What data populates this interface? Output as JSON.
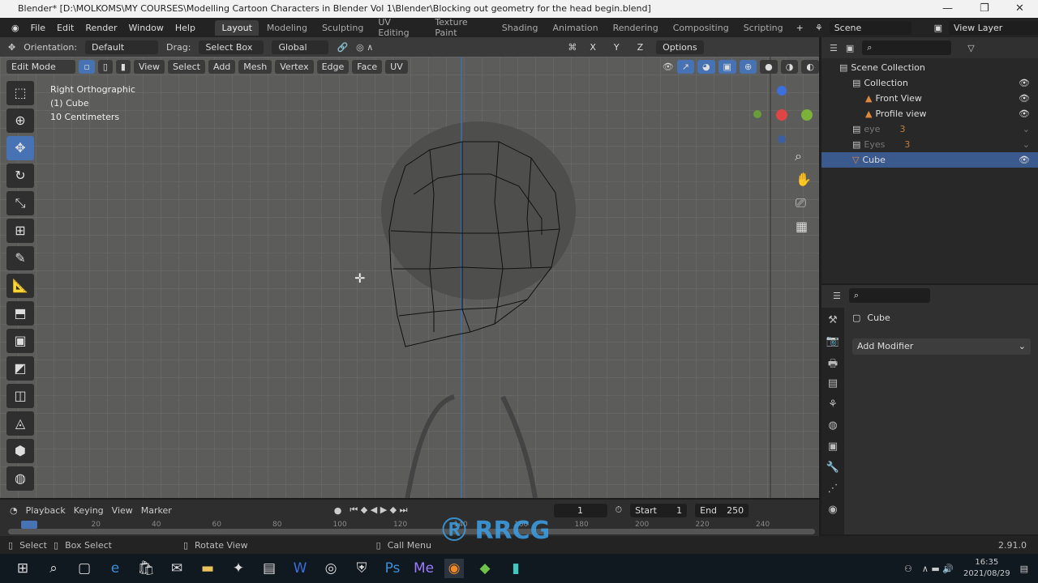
{
  "window": {
    "title": "Blender* [D:\\MOLKOMS\\MY COURSES\\Modelling  Cartoon Characters in Blender Vol 1\\Blender\\Blocking out geometry for the head begin.blend]"
  },
  "menu": [
    "File",
    "Edit",
    "Render",
    "Window",
    "Help"
  ],
  "workspaces": [
    "Layout",
    "Modeling",
    "Sculpting",
    "UV Editing",
    "Texture Paint",
    "Shading",
    "Animation",
    "Rendering",
    "Compositing",
    "Scripting"
  ],
  "scene": "Scene",
  "view_layer": "View Layer",
  "tool_header": {
    "orientation_label": "Orientation:",
    "orientation": "Default",
    "drag_label": "Drag:",
    "drag": "Select Box",
    "transform": "Global",
    "axes": [
      "X",
      "Y",
      "Z"
    ],
    "options": "Options"
  },
  "viewport_header": {
    "mode": "Edit Mode",
    "menus": [
      "View",
      "Select",
      "Add",
      "Mesh",
      "Vertex",
      "Edge",
      "Face",
      "UV"
    ]
  },
  "viewport_info": [
    "Right Orthographic",
    "(1) Cube",
    "10 Centimeters"
  ],
  "outliner": {
    "items": [
      {
        "label": "Scene Collection",
        "indent": 0
      },
      {
        "label": "Collection",
        "indent": 1
      },
      {
        "label": "Front View",
        "indent": 2
      },
      {
        "label": "Profile view",
        "indent": 2
      },
      {
        "label": "eye",
        "indent": 1,
        "dim": true,
        "badge": "3"
      },
      {
        "label": "Eyes",
        "indent": 1,
        "dim": true,
        "badge": "3"
      },
      {
        "label": "Cube",
        "indent": 1,
        "selected": true
      }
    ]
  },
  "properties": {
    "object": "Cube",
    "add_modifier": "Add Modifier"
  },
  "timeline": {
    "menus": [
      "Playback",
      "Keying",
      "View",
      "Marker"
    ],
    "current_frame": "1",
    "start_label": "Start",
    "start": "1",
    "end_label": "End",
    "end": "250",
    "ticks": [
      "20",
      "40",
      "60",
      "80",
      "100",
      "120",
      "140",
      "160",
      "180",
      "200",
      "220",
      "240"
    ]
  },
  "statusbar": {
    "items": [
      "Select",
      "Box Select",
      "Rotate View",
      "Call Menu"
    ],
    "version": "2.91.0"
  },
  "taskbar": {
    "time": "16:35",
    "date": "2021/08/29"
  },
  "watermark": "RRCG 人人素材",
  "colors": {
    "accent": "#4772b3",
    "selected_row": "#3a5a8e"
  }
}
